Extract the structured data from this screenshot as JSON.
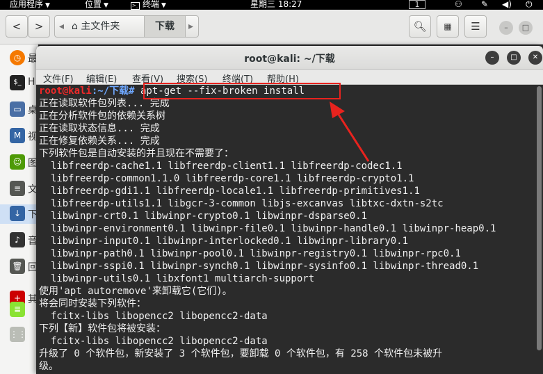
{
  "topbar": {
    "apps": "应用程序",
    "places": "位置",
    "terminal": "终端",
    "clock": "星期三 18:27",
    "workspace": "1"
  },
  "filemanager": {
    "home_crumb": "主文件夹",
    "current_crumb": "下载"
  },
  "sidebar": {
    "items": [
      {
        "label": "最",
        "icon": "recent-icon",
        "color": "#f57900"
      },
      {
        "label": "H",
        "icon": "home-terminal-icon",
        "color": "#222222"
      },
      {
        "label": "桌",
        "icon": "desktop-icon",
        "color": "#4a6fa5"
      },
      {
        "label": "视",
        "icon": "video-icon",
        "color": "#3465a4"
      },
      {
        "label": "图片",
        "icon": "pictures-icon",
        "color": "#4e9a06"
      },
      {
        "label": "文档",
        "icon": "documents-icon",
        "color": "#555753"
      },
      {
        "label": "下载",
        "icon": "downloads-icon",
        "color": "#3465a4"
      },
      {
        "label": "音乐",
        "icon": "music-icon",
        "color": "#333333"
      },
      {
        "label": "回收",
        "icon": "trash-icon",
        "color": "#555753"
      },
      {
        "label": "其",
        "icon": "other-icon",
        "color": "#cc0000"
      }
    ]
  },
  "terminal": {
    "title": "root@kali: ~/下载",
    "menu": [
      "文件(F)",
      "编辑(E)",
      "查看(V)",
      "搜索(S)",
      "终端(T)",
      "帮助(H)"
    ],
    "prompt_user": "root@kali",
    "prompt_path": ":~/下载#",
    "command": " apt-get --fix-broken install",
    "output": [
      "正在读取软件包列表... 完成",
      "正在分析软件包的依赖关系树",
      "正在读取状态信息... 完成",
      "正在修复依赖关系... 完成",
      "下列软件包是自动安装的并且现在不需要了：",
      "  libfreerdp-cache1.1 libfreerdp-client1.1 libfreerdp-codec1.1",
      "  libfreerdp-common1.1.0 libfreerdp-core1.1 libfreerdp-crypto1.1",
      "  libfreerdp-gdi1.1 libfreerdp-locale1.1 libfreerdp-primitives1.1",
      "  libfreerdp-utils1.1 libgcr-3-common libjs-excanvas libtxc-dxtn-s2tc",
      "  libwinpr-crt0.1 libwinpr-crypto0.1 libwinpr-dsparse0.1",
      "  libwinpr-environment0.1 libwinpr-file0.1 libwinpr-handle0.1 libwinpr-heap0.1",
      "  libwinpr-input0.1 libwinpr-interlocked0.1 libwinpr-library0.1",
      "  libwinpr-path0.1 libwinpr-pool0.1 libwinpr-registry0.1 libwinpr-rpc0.1",
      "  libwinpr-sspi0.1 libwinpr-synch0.1 libwinpr-sysinfo0.1 libwinpr-thread0.1",
      "  libwinpr-utils0.1 libxfont1 multiarch-support",
      "使用'apt autoremove'来卸载它(它们)。",
      "将会同时安装下列软件：",
      "  fcitx-libs libopencc2 libopencc2-data",
      "下列【新】软件包将被安装：",
      "  fcitx-libs libopencc2 libopencc2-data",
      "升级了 0 个软件包，新安装了 3 个软件包，要卸载 0 个软件包，有 258 个软件包未被升",
      "级。"
    ]
  },
  "colors": {
    "highlight": "#e8231e",
    "prompt_user": "#ef2929",
    "prompt_path": "#6fa8ff"
  }
}
